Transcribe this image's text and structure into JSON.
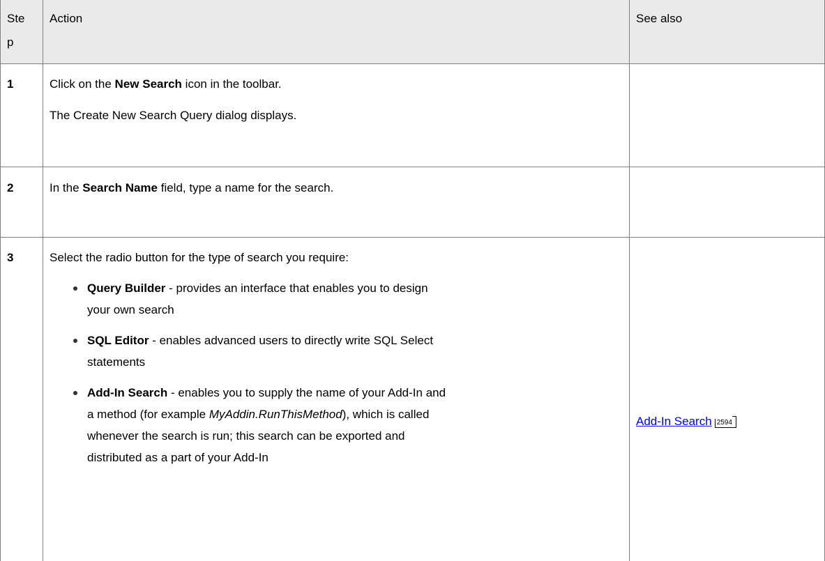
{
  "table": {
    "headers": {
      "step": "Step",
      "step_line1": "Ste",
      "step_line2": "p",
      "action": "Action",
      "see_also": "See also"
    },
    "rows": [
      {
        "step": "1",
        "action": {
          "p1_pre": "Click on the ",
          "p1_bold": "New Search",
          "p1_post": " icon in the toolbar.",
          "p2": "The Create New Search Query dialog displays."
        }
      },
      {
        "step": "2",
        "action": {
          "p1_pre": "In the ",
          "p1_bold": "Search Name",
          "p1_post": " field, type a name for the search."
        }
      },
      {
        "step": "3",
        "action": {
          "intro": "Select the radio button for the type of search you require:",
          "options": [
            {
              "name": "Query Builder",
              "line1": " - provides an interface that enables you to design",
              "line2": "your own search"
            },
            {
              "name": "SQL Editor",
              "line1": " - enables advanced users to directly write SQL Select",
              "line2": "statements"
            },
            {
              "name": "Add-In Search",
              "line1": " - enables you to supply the name of your Add-In and",
              "line2_pre": "a method (for example ",
              "line2_italic": "MyAddin.RunThisMethod",
              "line2_post": "), which is called",
              "line3": "whenever the search is run; this search can be exported and",
              "line4": "distributed as a part of your Add-In"
            }
          ]
        },
        "see_also": {
          "link_text": "Add-In Search",
          "page_ref": "2594"
        }
      }
    ]
  }
}
